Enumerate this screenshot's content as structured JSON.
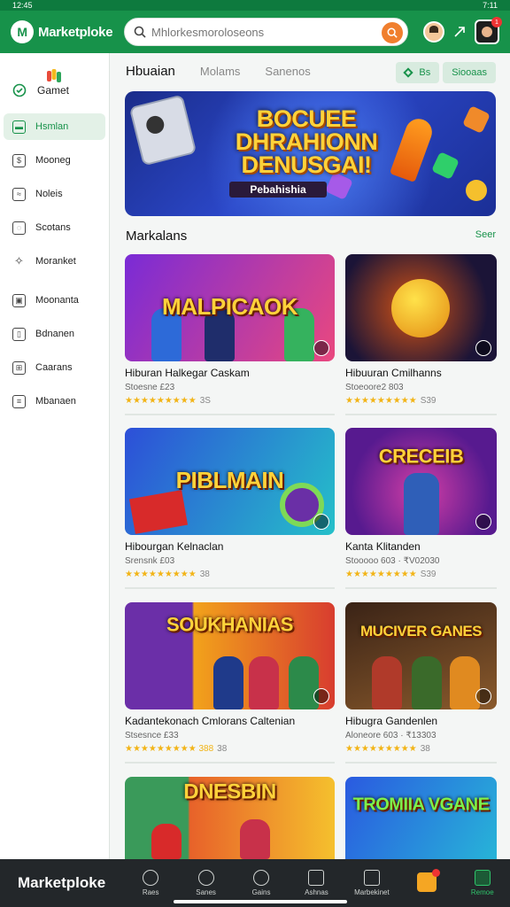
{
  "status": {
    "time": "12:45",
    "right": "7:11"
  },
  "app": {
    "name": "Marketploke"
  },
  "search": {
    "placeholder": "Mhlorkesmoroloseons"
  },
  "sidebar": {
    "top_label": "Gamet",
    "items": [
      {
        "label": "Hsmlan",
        "icon": "home-icon",
        "active": true
      },
      {
        "label": "Mooneg",
        "icon": "wallet-icon"
      },
      {
        "label": "Noleis",
        "icon": "bell-icon"
      },
      {
        "label": "Scotans",
        "icon": "controller-icon"
      },
      {
        "label": "Moranket",
        "icon": "tag-icon"
      },
      {
        "label": "Moonanta",
        "icon": "chart-icon"
      },
      {
        "label": "Bdnanen",
        "icon": "bookmark-icon"
      },
      {
        "label": "Caarans",
        "icon": "grid-icon"
      },
      {
        "label": "Mbanaen",
        "icon": "chat-icon"
      }
    ]
  },
  "tabs": [
    "Hbuaian",
    "Molams",
    "Sanenos"
  ],
  "filters": [
    "Bs",
    "Siooaas"
  ],
  "banner": {
    "title": "BOCUEE DHRAHIONN DENUSGAI!",
    "subtitle": "Pebahishia"
  },
  "section": {
    "title": "Markalans",
    "see_all": "Seer"
  },
  "cards": [
    {
      "image_text": "MALPICAOK",
      "title": "Hiburan Halkegar Caskam",
      "price": "Stoesne £23",
      "stars": "★★★★★★★★★",
      "rating": "3S",
      "colors": [
        "#7a2bd6",
        "#e9487f"
      ]
    },
    {
      "image_text": "",
      "title": "Hibuuran Cmilhanns",
      "price": "Stoeoore2 803",
      "stars": "★★★★★★★★★",
      "rating": "S39",
      "colors": [
        "#1b1437",
        "#d55314"
      ]
    },
    {
      "image_text": "PIBLMAIN",
      "title": "Hibourgan Kelnaclan",
      "price": "Srensnk £03",
      "stars": "★★★★★★★★★",
      "rating": "38",
      "colors": [
        "#2d4fd8",
        "#25c0c9"
      ]
    },
    {
      "image_text": "CRECEIB",
      "title": "Kanta Klitanden",
      "price": "Stooooo 603 ·  ₹V02030",
      "stars": "★★★★★★★★★",
      "rating": "S39",
      "colors": [
        "#571a8f",
        "#d33ea6"
      ]
    },
    {
      "image_text": "SOUKHANIAS",
      "title": "Kadantekonach Cmlorans Caltenian",
      "price": "Stsesnce £33",
      "stars": "★★★★★★★★★ 388",
      "rating": "38",
      "colors": [
        "#f2a21b",
        "#d83d2f"
      ]
    },
    {
      "image_text": "MUCIVER GANES",
      "title": "Hibugra Gandenlen",
      "price": "Aloneore 603 ·  ₹13303",
      "stars": "★★★★★★★★★",
      "rating": "38",
      "colors": [
        "#3a2316",
        "#8a5a2c"
      ]
    },
    {
      "image_text": "DNESBIN",
      "title": "",
      "price": "",
      "stars": "",
      "rating": "",
      "colors": [
        "#e8622a",
        "#f5c02d"
      ]
    },
    {
      "image_text": "TROMIIA VGANE",
      "title": "",
      "price": "",
      "stars": "",
      "rating": "",
      "colors": [
        "#2a5ae0",
        "#27b4d8"
      ]
    }
  ],
  "bottom_nav": {
    "brand": "Marketploke",
    "items": [
      {
        "label": "Raes"
      },
      {
        "label": "Sanes"
      },
      {
        "label": "Gains"
      },
      {
        "label": "Ashnas"
      },
      {
        "label": "Marbekinet"
      },
      {
        "label": ""
      },
      {
        "label": "Remoe",
        "active": true
      }
    ]
  },
  "colors": {
    "brand": "#17924a",
    "accent": "#f07f2e",
    "nav_bg": "#23272a",
    "star": "#f2b417"
  }
}
